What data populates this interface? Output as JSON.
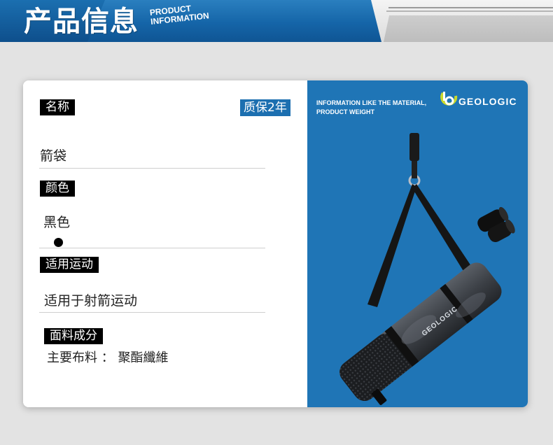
{
  "header": {
    "title": "产品信息",
    "subtitle_line1": "PRODUCT",
    "subtitle_line2": "INFORMATION",
    "accent_color": "#1565a8"
  },
  "fields": {
    "name_label": "名称",
    "warranty": "质保2年",
    "name_value": "箭袋",
    "color_label": "颜色",
    "color_value": "黑色",
    "swatch_color": "#000000",
    "sport_label": "适用运动",
    "sport_value": "适用于射箭运动",
    "fabric_label": "面料成分",
    "fabric_value": "主要布料 ： 聚酯纖維"
  },
  "image_panel": {
    "info_line1": "INFORMATION LIKE THE MATERIAL,",
    "info_line2": "PRODUCT WEIGHT",
    "brand": "GEOLOGIC",
    "bag_print": "GEOLOGIC",
    "background_color": "#1f75b6"
  }
}
